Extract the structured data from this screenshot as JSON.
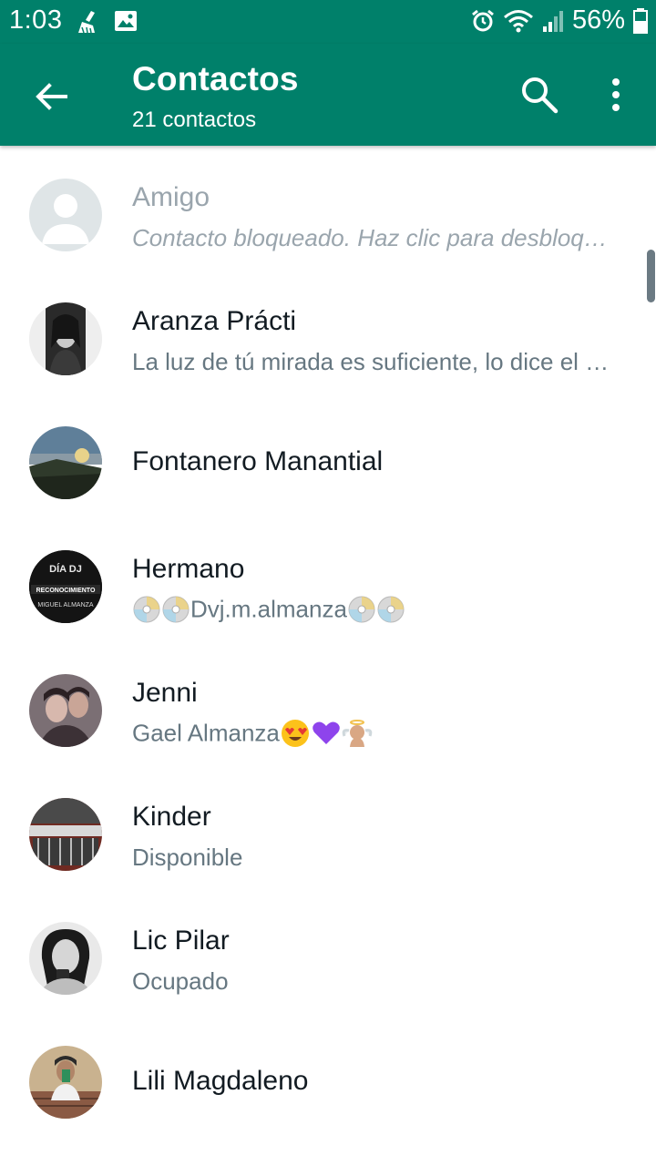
{
  "status_bar": {
    "time": "1:03",
    "battery": "56%",
    "left_icons": [
      "cleaner-icon",
      "image-icon"
    ],
    "right_icons": [
      "alarm-icon",
      "wifi-icon",
      "signal-icon",
      "battery-icon"
    ]
  },
  "app_bar": {
    "title": "Contactos",
    "subtitle": "21 contactos",
    "icons": [
      "back-arrow-icon",
      "search-icon",
      "more-vert-icon"
    ],
    "color": "#00806a"
  },
  "contacts": [
    {
      "name": "Amigo",
      "status": "Contacto bloqueado. Haz clic para desbloquear.",
      "blocked": true
    },
    {
      "name": "Aranza Prácti",
      "status": "La luz de tú mirada es suficiente, lo dice el corazón",
      "blocked": false
    },
    {
      "name": "Fontanero Manantial",
      "status": "",
      "blocked": false
    },
    {
      "name": "Hermano",
      "status_text": "Dvj.m.almanza",
      "status_emojis": [
        "dvd-icon",
        "dvd-icon",
        "dvd-icon",
        "dvd-icon"
      ],
      "blocked": false
    },
    {
      "name": "Jenni",
      "status_text": "Gael Almanza",
      "status_emojis": [
        "heart-eyes-emoji",
        "purple-heart-emoji",
        "baby-angel-emoji"
      ],
      "blocked": false
    },
    {
      "name": "Kinder",
      "status": "Disponible",
      "blocked": false
    },
    {
      "name": "Lic Pilar",
      "status": "Ocupado",
      "blocked": false
    },
    {
      "name": "Lili Magdaleno",
      "status": "",
      "blocked": false
    }
  ],
  "avatar_images": {
    "aranza": "portrait-photo",
    "fontanero": "landscape-photo",
    "hermano": "dj-poster-photo",
    "hermano_poster_text": [
      "DÍA DJ",
      "RECONOCIMIENTO",
      "MIGUEL ALMANZA"
    ],
    "jenni": "couple-photo",
    "kinder": "building-photo",
    "lic_pilar": "portrait-photo",
    "lili": "selfie-photo"
  }
}
